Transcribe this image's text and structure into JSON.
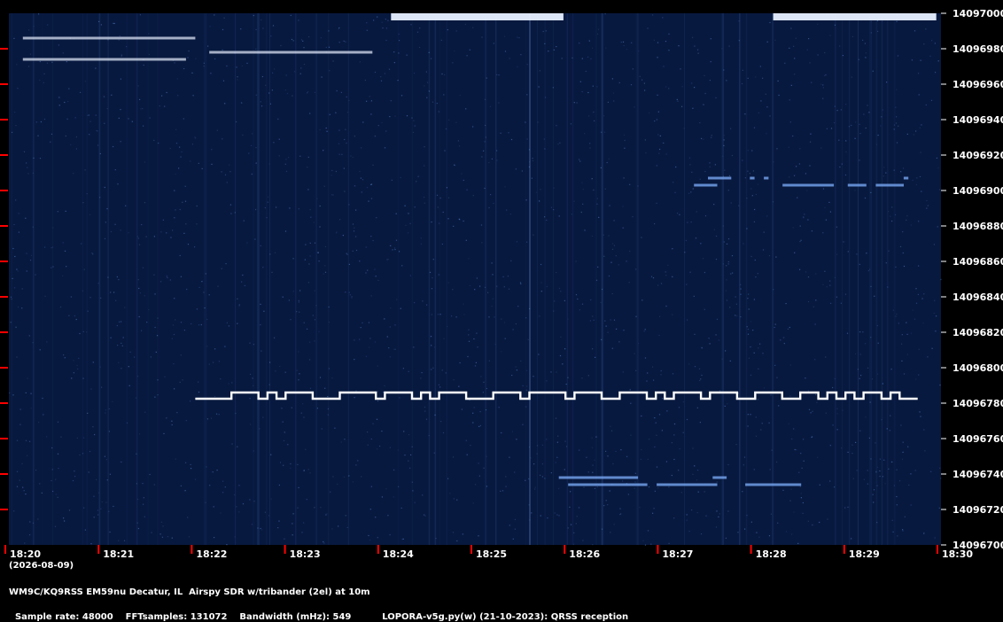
{
  "chart_data": {
    "type": "heatmap",
    "title": "",
    "xlabel": "",
    "ylabel": "",
    "date_label": "(2026-08-09)",
    "x_ticks": [
      "18:20",
      "18:21",
      "18:22",
      "18:23",
      "18:24",
      "18:25",
      "18:26",
      "18:27",
      "18:28",
      "18:29",
      "18:30"
    ],
    "y_ticks": [
      "14097000",
      "14096980",
      "14096960",
      "14096940",
      "14096920",
      "14096900",
      "14096880",
      "14096860",
      "14096840",
      "14096820",
      "14096800",
      "14096780",
      "14096760",
      "14096740",
      "14096720",
      "14096700"
    ],
    "x_range_minutes": [
      0,
      10
    ],
    "y_range_hz": [
      14096700,
      14097000
    ],
    "colors": {
      "background": "#08193f",
      "signal": "#ffffff",
      "tick": "#ff0000",
      "text": "#ffffff"
    },
    "signals": [
      {
        "name": "",
        "kind": "fsk-cw",
        "start_min": 2.0,
        "end_min": 9.75,
        "base_hz": 14096782.5,
        "shift_hz": 3.5,
        "key_pattern": [
          0,
          0,
          0,
          0,
          1,
          1,
          1,
          0,
          1,
          0,
          1,
          1,
          1,
          0,
          0,
          0,
          1,
          1,
          1,
          1,
          0,
          1,
          1,
          1,
          0,
          1,
          0,
          1,
          1,
          1,
          0,
          0,
          0,
          1,
          1,
          1,
          0,
          1,
          1,
          1,
          1,
          0,
          1,
          1,
          1,
          0,
          0,
          1,
          1,
          1,
          0,
          1,
          0,
          1,
          1,
          1,
          0,
          1,
          1,
          1,
          0,
          0,
          1,
          1,
          1,
          0,
          0,
          1,
          1,
          0,
          1,
          0,
          1,
          0,
          1,
          1,
          0,
          1,
          0,
          0
        ]
      },
      {
        "name": "",
        "kind": "carrier",
        "segments_min": [
          [
            0.15,
            2.0
          ]
        ],
        "hz": 14096986
      },
      {
        "name": "",
        "kind": "carrier",
        "segments_min": [
          [
            0.15,
            1.9
          ]
        ],
        "hz": 14096974
      },
      {
        "name": "",
        "kind": "carrier",
        "segments_min": [
          [
            2.15,
            3.9
          ]
        ],
        "hz": 14096978
      },
      {
        "name": "",
        "kind": "carrier-strong",
        "segments_min": [
          [
            4.1,
            5.95
          ],
          [
            8.2,
            9.95
          ]
        ],
        "hz": 14096998
      },
      {
        "name": "",
        "kind": "carrier-weak",
        "segments_min": [
          [
            7.35,
            7.6
          ]
        ],
        "hz": 14096903
      },
      {
        "name": "",
        "kind": "carrier-weak",
        "segments_min": [
          [
            7.5,
            7.75
          ],
          [
            7.95,
            8.0
          ],
          [
            8.1,
            8.15
          ]
        ],
        "hz": 14096907
      },
      {
        "name": "",
        "kind": "carrier-weak",
        "segments_min": [
          [
            8.3,
            8.85
          ],
          [
            9.0,
            9.2
          ],
          [
            9.3,
            9.6
          ]
        ],
        "hz": 14096903
      },
      {
        "name": "",
        "kind": "carrier-weak",
        "segments_min": [
          [
            9.6,
            9.65
          ]
        ],
        "hz": 14096907
      },
      {
        "name": "",
        "kind": "carrier-weak",
        "segments_min": [
          [
            5.9,
            6.75
          ],
          [
            7.55,
            7.7
          ]
        ],
        "hz": 14096738
      },
      {
        "name": "",
        "kind": "carrier-weak",
        "segments_min": [
          [
            6.0,
            6.85
          ],
          [
            6.95,
            7.6
          ],
          [
            7.9,
            8.5
          ]
        ],
        "hz": 14096734
      }
    ]
  },
  "info": {
    "line1": "WM9C/KQ9RSS EM59nu Decatur, IL  Airspy SDR w/tribander (2el) at 10m",
    "line2_items": [
      "Sample rate: 48000",
      "FFTsamples: 131072",
      "Bandwidth (mHz): 549",
      "LOPORA-v5g.py(w) (21-10-2023): QRSS reception"
    ]
  }
}
